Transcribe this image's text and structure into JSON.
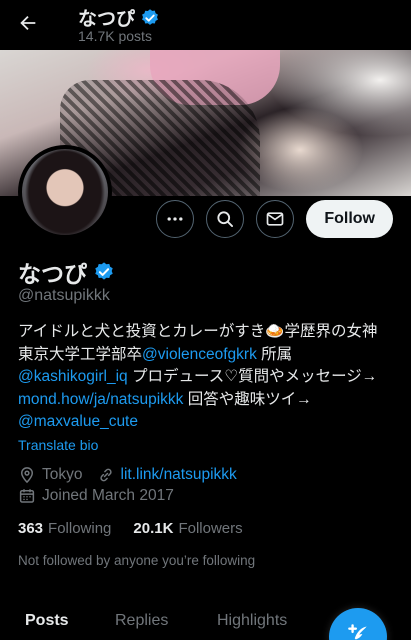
{
  "header": {
    "title": "なつぴ",
    "posts_count": "14.7K posts"
  },
  "profile": {
    "display_name": "なつぴ",
    "handle": "@natsupikkk",
    "follow_label": "Follow"
  },
  "bio": {
    "line1_text": "アイドルと犬と投資とカレーがすき🍛学歴界の女神",
    "line2_text": "東京大学工学部卒",
    "line2_link": "@violenceofgkrk",
    "line2_after": " 所属",
    "line3_link": "@kashikogirl_iq",
    "line3_after": " プロデュース♡質問やメッセージ→",
    "line4_link": "mond.how/ja/natsupikkk",
    "line4_after": " 回答や趣味ツイ→",
    "line5_link": "@maxvalue_cute",
    "translate_label": "Translate bio"
  },
  "meta": {
    "location": "Tokyo",
    "website": "lit.link/natsupikkk",
    "joined": "Joined March 2017"
  },
  "stats": {
    "following_count": "363",
    "following_label": "Following",
    "followers_count": "20.1K",
    "followers_label": "Followers"
  },
  "followed_by": "Not followed by anyone you’re following",
  "tabs": [
    {
      "label": "Posts"
    },
    {
      "label": "Replies"
    },
    {
      "label": "Highlights"
    }
  ],
  "icons": {
    "back": "back-arrow-icon",
    "verified": "verified-badge-icon",
    "more": "more-icon",
    "search": "search-icon",
    "message": "mail-icon",
    "location": "location-pin-icon",
    "link": "link-icon",
    "calendar": "calendar-icon",
    "compose": "compose-post-icon"
  },
  "colors": {
    "background": "#000000",
    "accent": "#1d9bf0",
    "text_primary": "#e7e9ea",
    "text_secondary": "#71767b",
    "follow_button_bg": "#eff3f4"
  }
}
